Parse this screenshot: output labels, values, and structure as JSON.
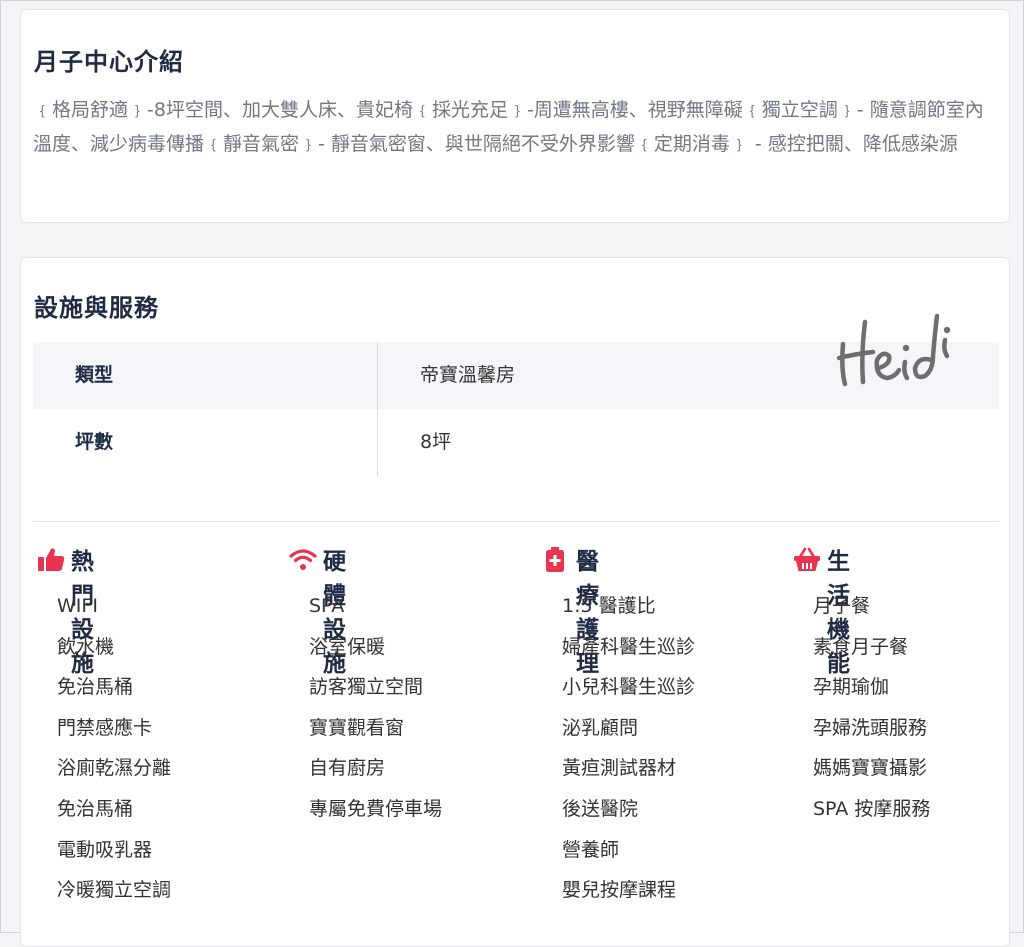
{
  "intro": {
    "title": "月子中心介紹",
    "text": "﹛格局舒適﹜-8坪空間、加大雙人床、貴妃椅﹛採光充足﹜-周遭無高樓、視野無障礙﹛獨立空調﹜- 隨意調節室內溫度、減少病毒傳播﹛靜音氣密﹜- 靜音氣密窗、與世隔絕不受外界影響﹛定期消毒﹜ - 感控把關、降低感染源"
  },
  "facilities": {
    "title": "設施與服務",
    "signature": "Heidi",
    "specs": [
      {
        "label": "類型",
        "value": "帝寶溫馨房"
      },
      {
        "label": "坪數",
        "value": "8坪"
      }
    ],
    "columns": [
      {
        "icon": "thumbs-up-icon",
        "title": "熱門設施",
        "items": [
          "WIFI",
          "飲水機",
          "免治馬桶",
          "門禁感應卡",
          "浴廁乾濕分離",
          "免治馬桶",
          "電動吸乳器",
          "冷暖獨立空調"
        ]
      },
      {
        "icon": "wifi-icon",
        "title": "硬體設施",
        "items": [
          "SPA",
          "浴室保暖",
          "訪客獨立空間",
          "寶寶觀看窗",
          "自有廚房",
          "專屬免費停車場"
        ]
      },
      {
        "icon": "medical-kit-icon",
        "title": "醫療護理",
        "items": [
          "1:5 醫護比",
          "婦產科醫生巡診",
          "小兒科醫生巡診",
          "泌乳顧問",
          "黃疸測試器材",
          "後送醫院",
          "營養師",
          "嬰兒按摩課程"
        ]
      },
      {
        "icon": "basket-icon",
        "title": "生活機能",
        "items": [
          "月子餐",
          "素食月子餐",
          "孕期瑜伽",
          "孕婦洗頭服務",
          "媽媽寶寶攝影",
          "SPA 按摩服務"
        ]
      }
    ]
  },
  "colors": {
    "accent": "#e8344e",
    "title": "#1f2a44",
    "muted": "#717885"
  }
}
